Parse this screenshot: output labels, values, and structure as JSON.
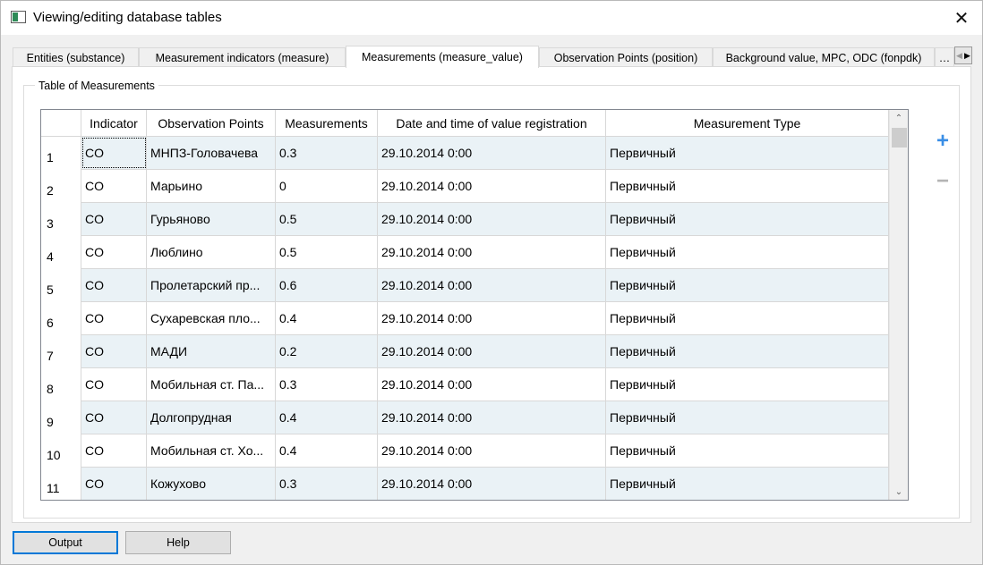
{
  "window": {
    "title": "Viewing/editing database tables",
    "close_glyph": "✕"
  },
  "tabs": [
    {
      "label": "Entities (substance)",
      "active": false
    },
    {
      "label": "Measurement indicators (measure)",
      "active": false
    },
    {
      "label": "Measurements (measure_value)",
      "active": true
    },
    {
      "label": "Observation Points (position)",
      "active": false
    },
    {
      "label": "Background value, MPC, ODC (fonpdk)",
      "active": false
    },
    {
      "label": "…",
      "active": false
    }
  ],
  "tab_scroll": {
    "left_glyph": "◀",
    "right_glyph": "▶"
  },
  "group": {
    "title": "Table of Measurements"
  },
  "table": {
    "columns": [
      "Indicator",
      "Observation Points",
      "Measurements",
      "Date and time of value registration",
      "Measurement Type"
    ],
    "rows": [
      {
        "num": "1",
        "indicator": "CO",
        "point": "МНПЗ-Головачева",
        "value": "0.3",
        "datetime": "29.10.2014 0:00",
        "type": "Первичный"
      },
      {
        "num": "2",
        "indicator": "CO",
        "point": "Марьино",
        "value": "0",
        "datetime": "29.10.2014 0:00",
        "type": "Первичный"
      },
      {
        "num": "3",
        "indicator": "CO",
        "point": "Гурьяново",
        "value": "0.5",
        "datetime": "29.10.2014 0:00",
        "type": "Первичный"
      },
      {
        "num": "4",
        "indicator": "CO",
        "point": "Люблино",
        "value": "0.5",
        "datetime": "29.10.2014 0:00",
        "type": "Первичный"
      },
      {
        "num": "5",
        "indicator": "CO",
        "point": "Пролетарский пр...",
        "value": "0.6",
        "datetime": "29.10.2014 0:00",
        "type": "Первичный"
      },
      {
        "num": "6",
        "indicator": "CO",
        "point": "Сухаревская пло...",
        "value": "0.4",
        "datetime": "29.10.2014 0:00",
        "type": "Первичный"
      },
      {
        "num": "7",
        "indicator": "CO",
        "point": "МАДИ",
        "value": "0.2",
        "datetime": "29.10.2014 0:00",
        "type": "Первичный"
      },
      {
        "num": "8",
        "indicator": "CO",
        "point": "Мобильная ст. Па...",
        "value": "0.3",
        "datetime": "29.10.2014 0:00",
        "type": "Первичный"
      },
      {
        "num": "9",
        "indicator": "CO",
        "point": "Долгопрудная",
        "value": "0.4",
        "datetime": "29.10.2014 0:00",
        "type": "Первичный"
      },
      {
        "num": "10",
        "indicator": "CO",
        "point": "Мобильная ст. Хо...",
        "value": "0.4",
        "datetime": "29.10.2014 0:00",
        "type": "Первичный"
      },
      {
        "num": "11",
        "indicator": "CO",
        "point": "Кожухово",
        "value": "0.3",
        "datetime": "29.10.2014 0:00",
        "type": "Первичный"
      }
    ]
  },
  "scrollbar": {
    "up_glyph": "⌃",
    "down_glyph": "⌄"
  },
  "side_buttons": {
    "add_glyph": "+",
    "remove_glyph": "−"
  },
  "buttons": {
    "output": "Output",
    "help": "Help"
  }
}
